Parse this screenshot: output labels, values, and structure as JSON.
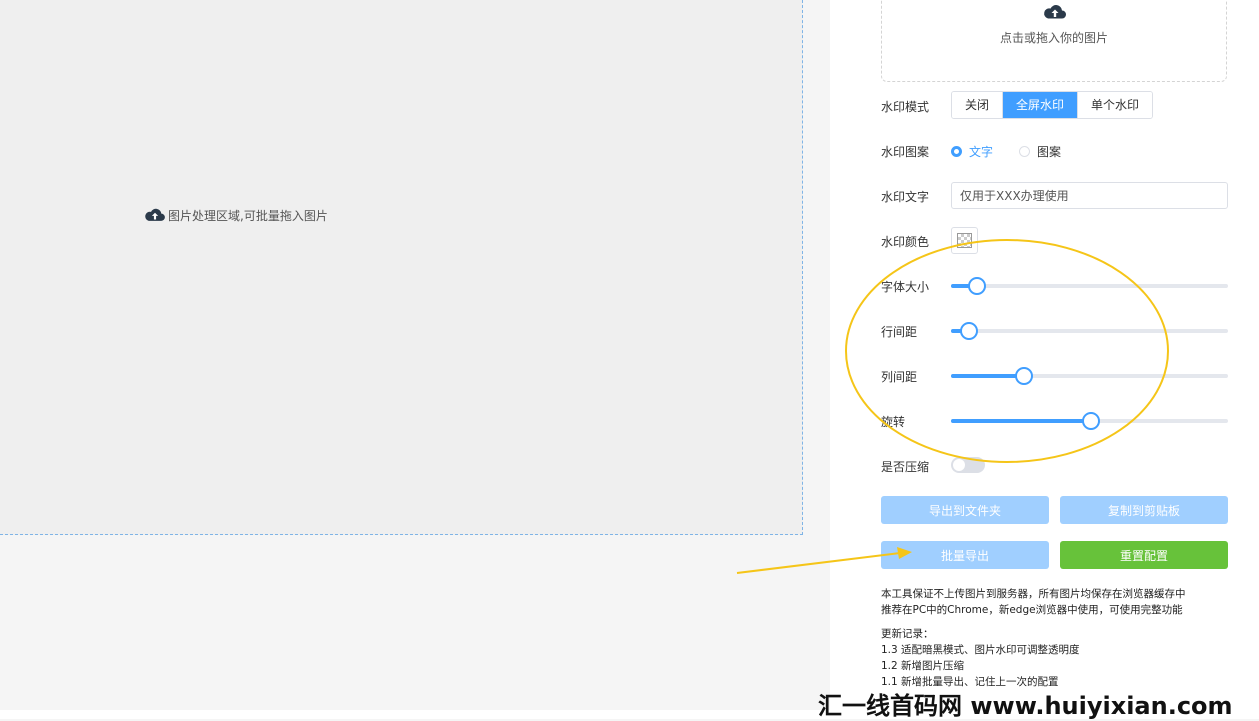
{
  "drop_area": {
    "hint": "图片处理区域,可批量拖入图片"
  },
  "upload": {
    "text": "点击或拖入你的图片"
  },
  "labels": {
    "mode": "水印模式",
    "element": "水印图案",
    "text": "水印文字",
    "color": "水印颜色",
    "font_size": "字体大小",
    "line_spacing": "行间距",
    "col_spacing": "列间距",
    "rotate": "旋转",
    "compress": "是否压缩"
  },
  "mode_options": [
    "关闭",
    "全屏水印",
    "单个水印"
  ],
  "mode_selected": "全屏水印",
  "element_options": [
    "文字",
    "图案"
  ],
  "element_selected": "文字",
  "watermark_text": "仅用于XXX办理使用",
  "sliders": {
    "font_size": 0.09,
    "line_spacing": 0.06,
    "col_spacing": 0.26,
    "rotate": 0.5
  },
  "compress_on": false,
  "buttons": {
    "export_folder": "导出到文件夹",
    "copy_clipboard": "复制到剪贴板",
    "batch_export": "批量导出",
    "reset": "重置配置"
  },
  "notes": {
    "line1": "本工具保证不上传图片到服务器，所有图片均保存在浏览器缓存中",
    "line2": "推荐在PC中的Chrome，新edge浏览器中使用，可使用完整功能",
    "changelog_title": "更新记录：",
    "changelog": [
      "1.3 适配暗黑模式、图片水印可调整透明度",
      "1.2 新增图片压缩",
      "1.1 新增批量导出、记住上一次的配置"
    ]
  },
  "watermark": "汇一线首码网 www.huiyixian.com",
  "colors": {
    "primary": "#409eff",
    "success": "#67c23a",
    "annotation": "#f5c518"
  }
}
